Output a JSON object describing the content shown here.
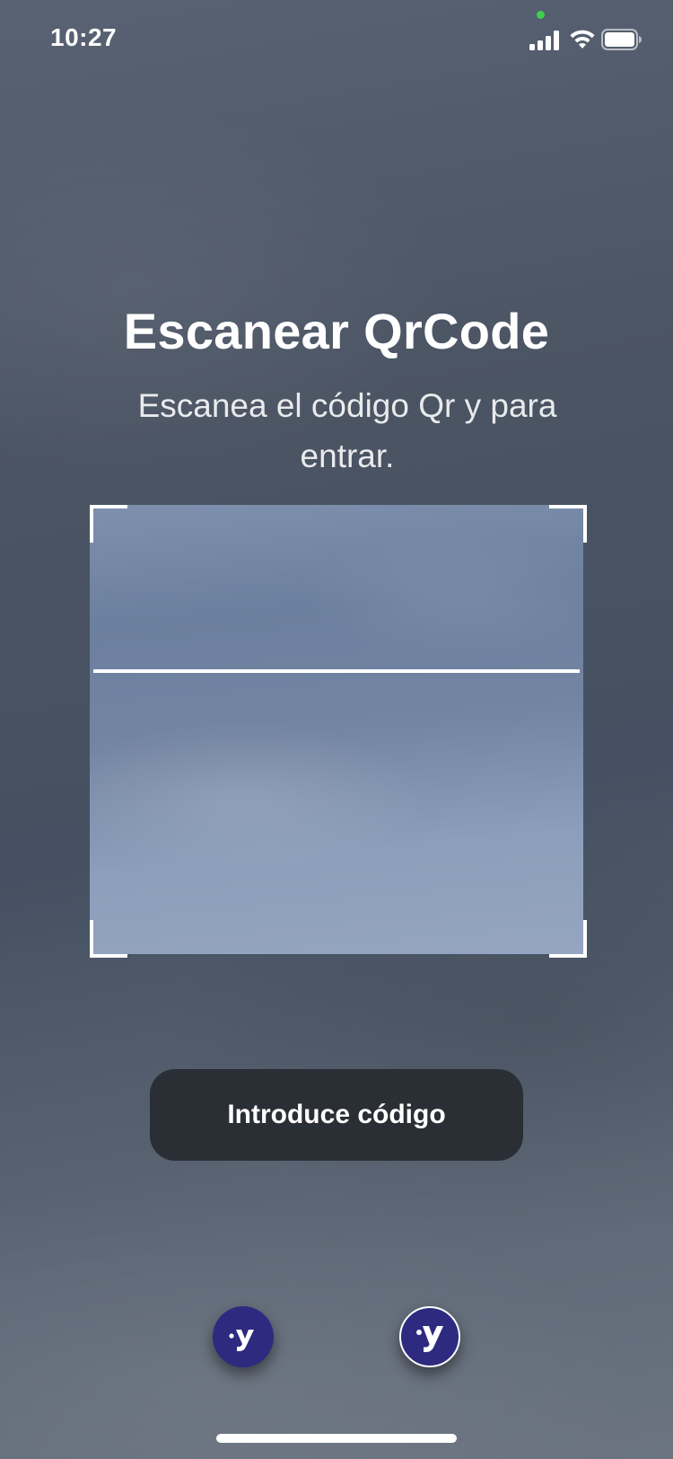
{
  "status_bar": {
    "time": "10:27",
    "icons": [
      "signal-icon",
      "wifi-icon",
      "battery-icon"
    ],
    "mic_indicator_color": "#3ccf4e"
  },
  "scanner_screen": {
    "title": "Escanear QrCode",
    "subtitle": "Escanea el código Qr y para entrar."
  },
  "actions": {
    "enter_code_label": "Introduce código"
  },
  "app_icons": [
    {
      "name": "app-logo-icon",
      "color": "#2e2a80"
    },
    {
      "name": "app-logo-icon-outlined",
      "color": "#2e2a80"
    }
  ],
  "colors": {
    "button_bg": "#2a2e35",
    "brand": "#2e2a80",
    "scan_frame": "#ffffff"
  }
}
